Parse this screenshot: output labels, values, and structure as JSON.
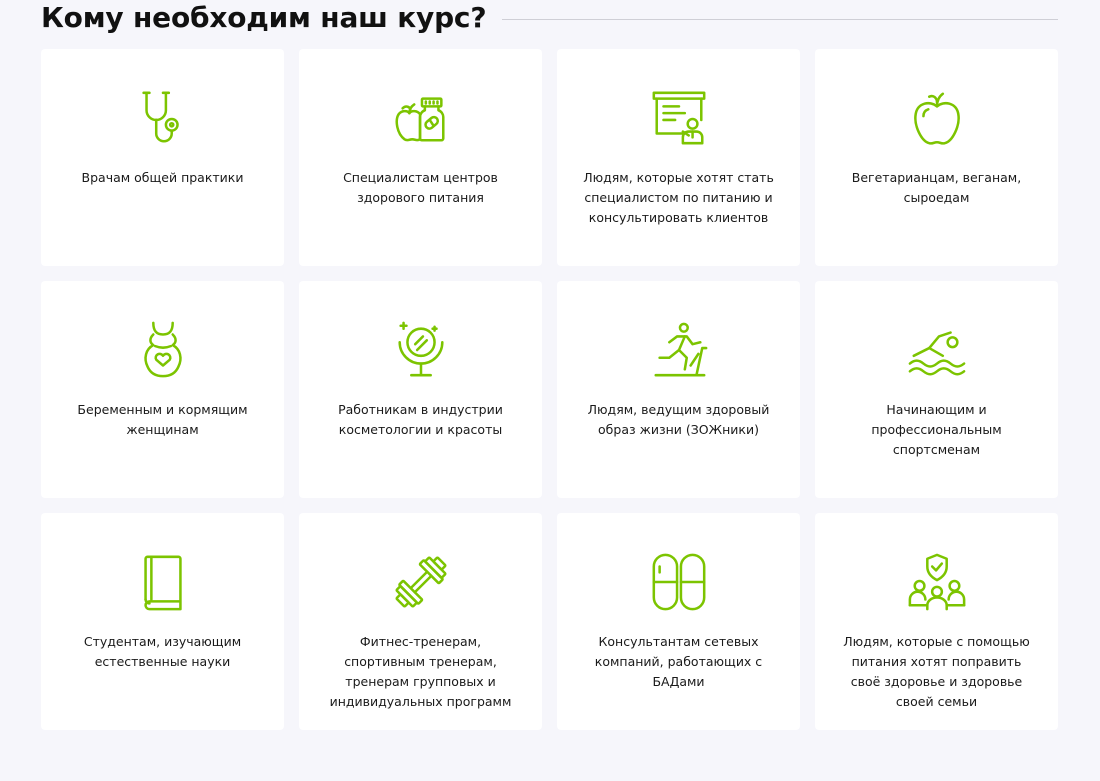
{
  "header": {
    "title": "Кому необходим наш курс?"
  },
  "accent_color": "#7cc400",
  "cards": [
    {
      "icon": "stethoscope-icon",
      "text": "Врачам общей практики"
    },
    {
      "icon": "apple-and-pill-jar-icon",
      "text": "Специалистам центров здорового питания"
    },
    {
      "icon": "presenter-board-icon",
      "text": "Людям, которые хотят стать специалистом по питанию и консультировать клиентов"
    },
    {
      "icon": "apple-icon",
      "text": "Вегетарианцам, веганам, сыроедам"
    },
    {
      "icon": "pregnant-woman-icon",
      "text": "Беременным и кормящим женщинам"
    },
    {
      "icon": "cosmetic-mirror-icon",
      "text": "Работникам в индустрии косметологии и красоты"
    },
    {
      "icon": "running-person-icon",
      "text": "Людям, ведущим здоровый образ жизни (ЗОЖники)"
    },
    {
      "icon": "swimmer-icon",
      "text": "Начинающим и профессиональным спортсменам"
    },
    {
      "icon": "book-icon",
      "text": "Студентам, изучающим естественные науки"
    },
    {
      "icon": "dumbbell-icon",
      "text": "Фитнес-тренерам, спортивным тренерам, тренерам групповых и индивидуальных программ"
    },
    {
      "icon": "capsules-icon",
      "text": "Консультантам сетевых компаний, работающих с БАДами"
    },
    {
      "icon": "family-shield-icon",
      "text": "Людям, которые с помощью питания хотят поправить своё здоровье и здоровье своей семьи"
    }
  ]
}
